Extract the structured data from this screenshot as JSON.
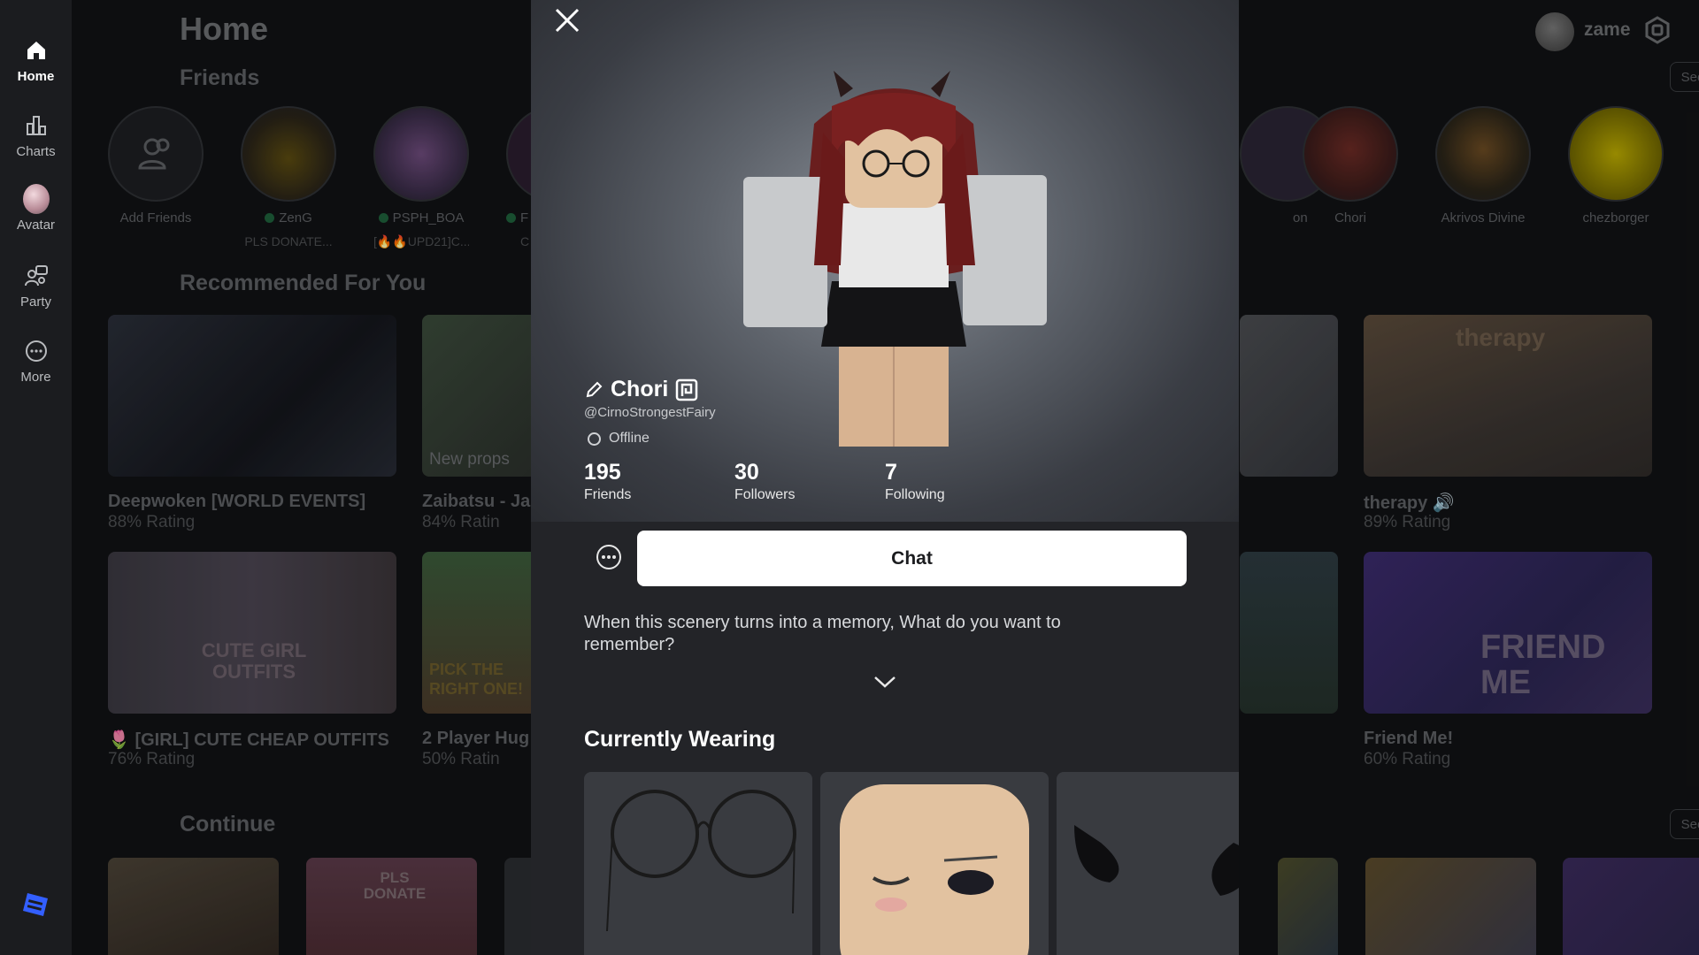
{
  "sidebar": {
    "items": [
      {
        "label": "Home",
        "icon": "home-icon"
      },
      {
        "label": "Charts",
        "icon": "charts-icon"
      },
      {
        "label": "Avatar",
        "icon": "avatar-icon"
      },
      {
        "label": "Party",
        "icon": "party-icon"
      },
      {
        "label": "More",
        "icon": "more-icon"
      }
    ],
    "logo": "roblox-logo-icon"
  },
  "header": {
    "title": "Home",
    "username": "zame"
  },
  "friends": {
    "title": "Friends",
    "see_all": "See All",
    "add_friends": "Add Friends",
    "items": [
      {
        "name": "ZenG",
        "sub": "PLS DONATE..."
      },
      {
        "name": "PSPH_BOA",
        "sub": "[🔥🔥UPD21]C..."
      },
      {
        "name": "F",
        "sub": "C"
      },
      {
        "name": "on"
      },
      {
        "name": "Chori"
      },
      {
        "name": "Akrivos Divine"
      },
      {
        "name": "chezborger"
      }
    ]
  },
  "recommended": {
    "title": "Recommended For You",
    "games": [
      {
        "name": "Deepwoken [WORLD EVENTS]",
        "rating": "88% Rating"
      },
      {
        "name": "Zaibatsu - Ja",
        "rating": "84% Ratin",
        "overlay": "New props"
      },
      {
        "name": "therapy 🔊",
        "rating": "89% Rating",
        "overlay": "therapy"
      },
      {
        "name": "🌷 [GIRL] CUTE CHEAP OUTFITS",
        "rating": "76% Rating",
        "overlay": "CUTE GIRL OUTFITS"
      },
      {
        "name": "2 Player Hug",
        "rating": "50% Ratin",
        "overlay": "PICK THE RIGHT ONE!"
      },
      {
        "name": "Friend Me!",
        "rating": "60% Rating",
        "overlay": "FRIEND ME"
      }
    ]
  },
  "continue": {
    "title": "Continue",
    "see_all": "See All",
    "tile_text": "PLS DONATE"
  },
  "profile": {
    "display_name": "Chori",
    "username": "@CirnoStrongestFairy",
    "status": "Offline",
    "stats": [
      {
        "value": "195",
        "label": "Friends"
      },
      {
        "value": "30",
        "label": "Followers"
      },
      {
        "value": "7",
        "label": "Following"
      }
    ],
    "chat_label": "Chat",
    "bio": "When this scenery turns into a memory, What do you want to remember?",
    "currently_wearing_title": "Currently Wearing"
  },
  "colors": {
    "accent": "#335fff",
    "online": "#1e5e3a"
  }
}
